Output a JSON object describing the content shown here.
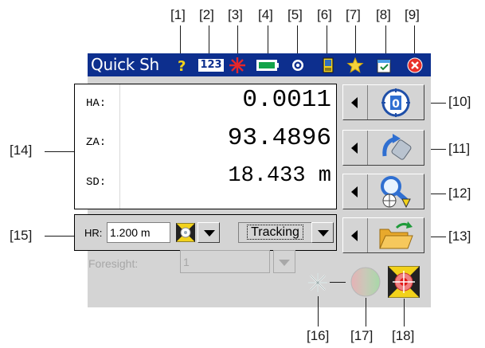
{
  "callouts": {
    "c1": "[1]",
    "c2": "[2]",
    "c3": "[3]",
    "c4": "[4]",
    "c5": "[5]",
    "c6": "[6]",
    "c7": "[7]",
    "c8": "[8]",
    "c9": "[9]",
    "c10": "[10]",
    "c11": "[11]",
    "c12": "[12]",
    "c13": "[13]",
    "c14": "[14]",
    "c15": "[15]",
    "c16": "[16]",
    "c17": "[17]",
    "c18": "[18]"
  },
  "titlebar": {
    "title": "Quick Sh",
    "icons": [
      "help-icon",
      "input-mode-icon",
      "laser-icon",
      "battery-icon",
      "settings-icon",
      "device-icon",
      "favorites-icon",
      "task-icon",
      "close-icon"
    ],
    "input_mode_text": "123"
  },
  "measurement": {
    "rows": [
      {
        "label": "HA:",
        "value": "0.0011"
      },
      {
        "label": "ZA:",
        "value": "93.4896"
      },
      {
        "label": "SD:",
        "value": "18.433 m"
      }
    ]
  },
  "side_buttons": [
    {
      "icon": "measure-icon",
      "digit": "0"
    },
    {
      "icon": "instrument-turn-icon"
    },
    {
      "icon": "search-target-icon"
    },
    {
      "icon": "open-folder-icon"
    }
  ],
  "hr": {
    "label": "HR:",
    "value": "1.200 m",
    "mode": "Tracking"
  },
  "foresight": {
    "label": "Foresight:",
    "value": "1"
  },
  "status_icons": [
    "laser-pointer-icon",
    "status-light-icon",
    "target-prism-icon"
  ],
  "colors": {
    "titlebar": "#0d2f8e",
    "screen_bg": "#d4d4d4",
    "disabled_text": "#a7a7a7"
  }
}
